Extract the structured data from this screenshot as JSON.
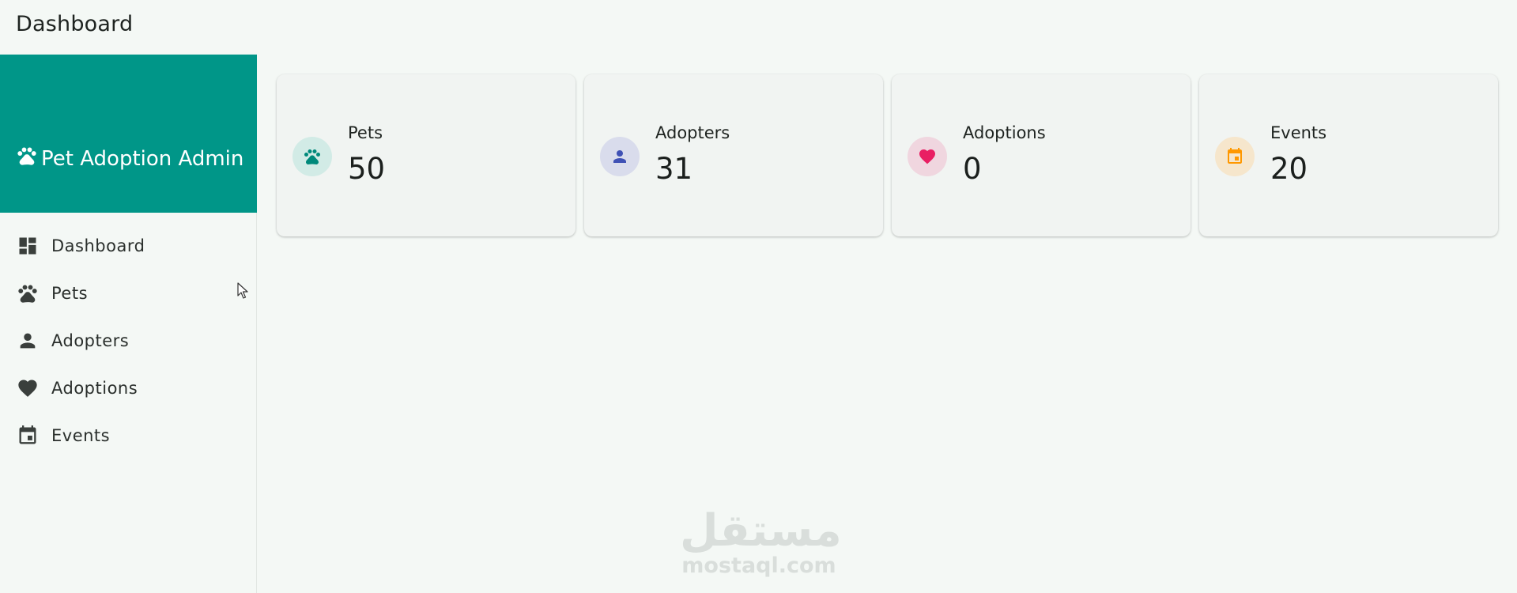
{
  "appbar": {
    "title": "Dashboard"
  },
  "sidebar": {
    "brand": "Pet Adoption Admin",
    "brand_color": "#009688",
    "items": [
      {
        "label": "Dashboard",
        "icon": "dashboard-icon"
      },
      {
        "label": "Pets",
        "icon": "paw-icon"
      },
      {
        "label": "Adopters",
        "icon": "person-icon"
      },
      {
        "label": "Adoptions",
        "icon": "heart-icon"
      },
      {
        "label": "Events",
        "icon": "calendar-icon"
      }
    ]
  },
  "cards": [
    {
      "label": "Pets",
      "value": "50",
      "icon": "paw-icon",
      "color": "#00897b",
      "bg": "#d2ebe6"
    },
    {
      "label": "Adopters",
      "value": "31",
      "icon": "person-icon",
      "color": "#3f51b5",
      "bg": "#d9dcec"
    },
    {
      "label": "Adoptions",
      "value": "0",
      "icon": "heart-icon",
      "color": "#e91e63",
      "bg": "#f0d6df"
    },
    {
      "label": "Events",
      "value": "20",
      "icon": "calendar-icon",
      "color": "#ff9800",
      "bg": "#f6e6cc"
    }
  ],
  "watermark": {
    "arabic": "مستقل",
    "latin": "mostaql.com"
  }
}
